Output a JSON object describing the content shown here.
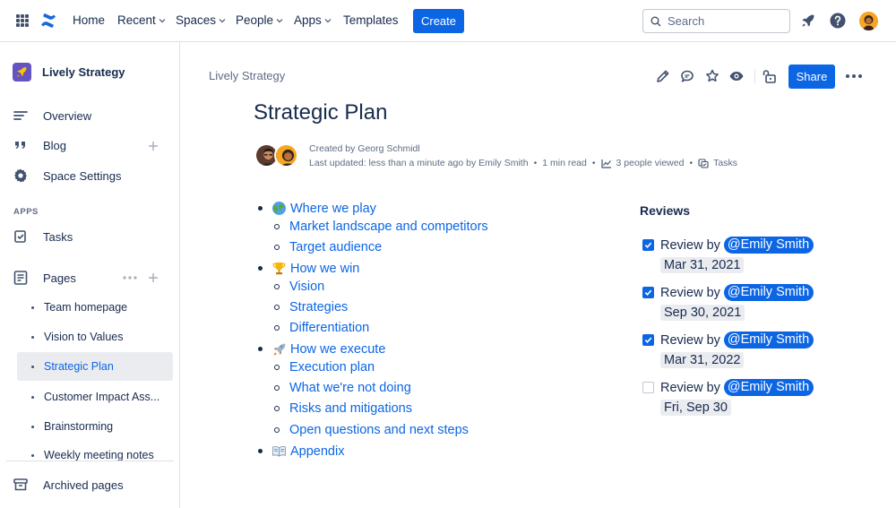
{
  "topnav": {
    "items": [
      {
        "label": "Home",
        "dropdown": false
      },
      {
        "label": "Recent",
        "dropdown": true
      },
      {
        "label": "Spaces",
        "dropdown": true
      },
      {
        "label": "People",
        "dropdown": true
      },
      {
        "label": "Apps",
        "dropdown": true
      },
      {
        "label": "Templates",
        "dropdown": false
      }
    ],
    "create_label": "Create",
    "search_placeholder": "Search",
    "icons": [
      "app-switcher-icon",
      "confluence-logo-icon",
      "search-icon",
      "rocket-notifications-icon",
      "help-icon",
      "user-avatar"
    ]
  },
  "sidebar": {
    "space_name": "Lively Strategy",
    "items": [
      {
        "label": "Overview",
        "icon": "overview-icon"
      },
      {
        "label": "Blog",
        "icon": "quote-icon"
      },
      {
        "label": "Space Settings",
        "icon": "gear-icon"
      }
    ],
    "apps_label": "APPS",
    "apps": [
      {
        "label": "Tasks",
        "icon": "tasks-icon"
      }
    ],
    "pages_label": "Pages",
    "pages": [
      {
        "label": "Team homepage",
        "active": false
      },
      {
        "label": "Vision to Values",
        "active": false
      },
      {
        "label": "Strategic Plan",
        "active": true
      },
      {
        "label": "Customer Impact Ass...",
        "active": false
      },
      {
        "label": "Brainstorming",
        "active": false
      },
      {
        "label": "Weekly meeting notes",
        "active": false
      }
    ],
    "archived_label": "Archived pages"
  },
  "page": {
    "breadcrumb": "Lively Strategy",
    "share_label": "Share",
    "title": "Strategic Plan",
    "created_by": "Created by Georg Schmidl",
    "last_updated": "Last updated: less than a minute ago by Emily Smith",
    "read_time": "1 min read",
    "views": "3 people viewed",
    "tasks": "Tasks"
  },
  "outline": {
    "sections": [
      {
        "label": "Where we play",
        "emoji": "globe-icon",
        "children": [
          "Market landscape and competitors",
          "Target audience"
        ]
      },
      {
        "label": "How we win",
        "emoji": "trophy-icon",
        "children": [
          "Vision",
          "Strategies",
          "Differentiation"
        ]
      },
      {
        "label": "How we execute",
        "emoji": "rocket-icon",
        "children": [
          "Execution plan",
          "What we're not doing",
          "Risks and mitigations",
          "Open questions and next steps"
        ]
      },
      {
        "label": "Appendix",
        "emoji": "book-icon",
        "children": []
      }
    ]
  },
  "reviews": {
    "title": "Reviews",
    "items": [
      {
        "text": "Review by",
        "mention": "@Emily Smith",
        "date": "Mar 31, 2021",
        "checked": true
      },
      {
        "text": "Review by",
        "mention": "@Emily Smith",
        "date": "Sep 30, 2021",
        "checked": true
      },
      {
        "text": "Review by",
        "mention": "@Emily Smith",
        "date": "Mar 31, 2022",
        "checked": true
      },
      {
        "text": "Review by",
        "mention": "@Emily Smith",
        "date": "Fri, Sep 30",
        "checked": false
      }
    ]
  },
  "colors": {
    "accent": "#0c66e4",
    "text": "#172b4d",
    "subtle": "#5e6c84",
    "border": "#dfe1e6"
  }
}
